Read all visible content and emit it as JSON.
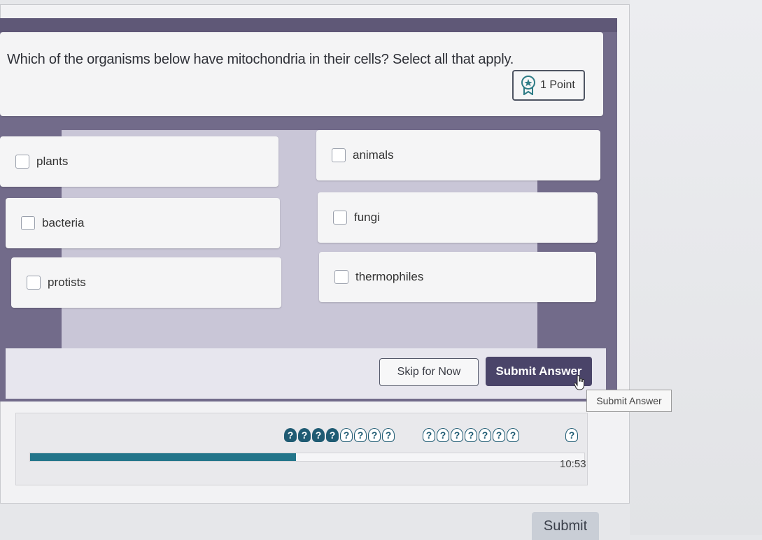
{
  "question": {
    "text": "Which of the organisms below have mitochondria in their cells? Select all that apply.",
    "points_label": "1 Point"
  },
  "options": [
    {
      "label": "plants"
    },
    {
      "label": "animals"
    },
    {
      "label": "bacteria"
    },
    {
      "label": "fungi"
    },
    {
      "label": "protists"
    },
    {
      "label": "thermophiles"
    }
  ],
  "actions": {
    "skip_label": "Skip for Now",
    "submit_label": "Submit Answer",
    "tooltip": "Submit Answer"
  },
  "progress": {
    "group1": [
      {
        "state": "answered",
        "symbol": "?"
      },
      {
        "state": "answered",
        "symbol": "?"
      },
      {
        "state": "answered",
        "symbol": "?"
      },
      {
        "state": "answered",
        "symbol": "?"
      },
      {
        "state": "unanswered",
        "symbol": "?"
      },
      {
        "state": "unanswered",
        "symbol": "?"
      },
      {
        "state": "unanswered",
        "symbol": "?"
      },
      {
        "state": "unanswered",
        "symbol": "?"
      }
    ],
    "group2": [
      {
        "state": "unanswered",
        "symbol": "?"
      },
      {
        "state": "unanswered",
        "symbol": "?"
      },
      {
        "state": "unanswered",
        "symbol": "?"
      },
      {
        "state": "unanswered",
        "symbol": "?"
      },
      {
        "state": "unanswered",
        "symbol": "?"
      },
      {
        "state": "unanswered",
        "symbol": "?"
      },
      {
        "state": "unanswered",
        "symbol": "?"
      }
    ],
    "extra": {
      "state": "unanswered",
      "symbol": "?"
    },
    "fraction_complete": 0.48,
    "timer": "10:53"
  },
  "page": {
    "submit_label": "Submit"
  },
  "colors": {
    "frame": "#726b8a",
    "primary_button": "#4a4469",
    "progress_fill": "#23758a",
    "question_icon": "#1f5b73"
  }
}
